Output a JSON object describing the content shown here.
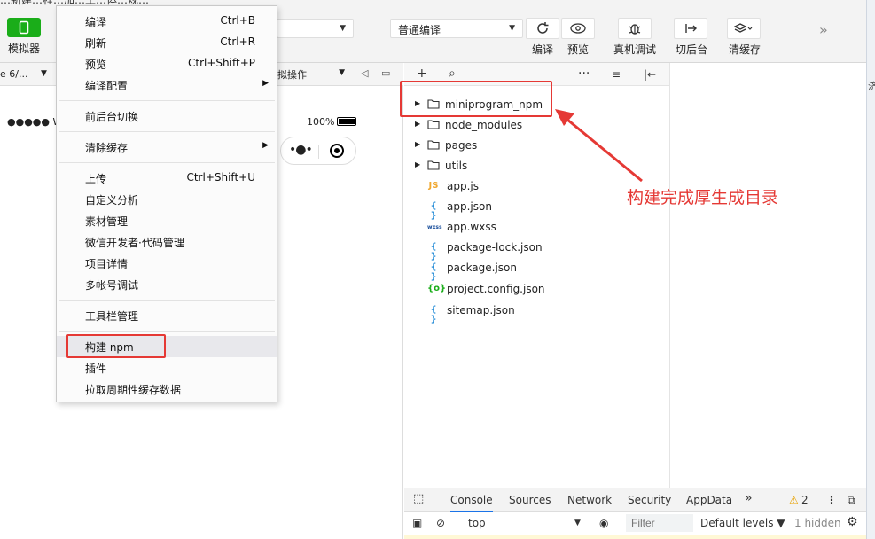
{
  "title_strip": "…新建…程…加…工…体…规…",
  "toolbar": {
    "simulator": "模拟器",
    "mode_select": "",
    "compile_select": "普通编译",
    "compile": "编译",
    "preview": "预览",
    "real_debug": "真机调试",
    "background": "切后台",
    "clear_cache": "清缓存",
    "more": "»"
  },
  "sim_bar": {
    "device": "e 6/...",
    "ops": "拟操作"
  },
  "phone": {
    "carrier": "●●●●● We",
    "battery": "100%"
  },
  "menu": {
    "items": [
      {
        "label": "编译",
        "shortcut": "Ctrl+B"
      },
      {
        "label": "刷新",
        "shortcut": "Ctrl+R"
      },
      {
        "label": "预览",
        "shortcut": "Ctrl+Shift+P"
      },
      {
        "label": "编译配置",
        "shortcut": ""
      },
      {
        "label": "前后台切换",
        "shortcut": ""
      },
      {
        "label": "清除缓存",
        "shortcut": ""
      },
      {
        "label": "上传",
        "shortcut": "Ctrl+Shift+U"
      },
      {
        "label": "自定义分析",
        "shortcut": ""
      },
      {
        "label": "素材管理",
        "shortcut": ""
      },
      {
        "label": "微信开发者·代码管理",
        "shortcut": ""
      },
      {
        "label": "项目详情",
        "shortcut": ""
      },
      {
        "label": "多帐号调试",
        "shortcut": ""
      },
      {
        "label": "工具栏管理",
        "shortcut": ""
      },
      {
        "label": "构建 npm",
        "shortcut": ""
      },
      {
        "label": "插件",
        "shortcut": ""
      },
      {
        "label": "拉取周期性缓存数据",
        "shortcut": ""
      }
    ]
  },
  "tree": {
    "files": [
      {
        "name": "miniprogram_npm",
        "type": "folder"
      },
      {
        "name": "node_modules",
        "type": "folder"
      },
      {
        "name": "pages",
        "type": "folder"
      },
      {
        "name": "utils",
        "type": "folder"
      },
      {
        "name": "app.js",
        "type": "js",
        "icon": "JS",
        "color": "#f0a830"
      },
      {
        "name": "app.json",
        "type": "json",
        "icon": "{ }",
        "color": "#2a8fd8"
      },
      {
        "name": "app.wxss",
        "type": "wxss",
        "icon": "wxss",
        "color": "#1a4f9c"
      },
      {
        "name": "package-lock.json",
        "type": "json",
        "icon": "{ }",
        "color": "#2a8fd8"
      },
      {
        "name": "package.json",
        "type": "json",
        "icon": "{ }",
        "color": "#2a8fd8"
      },
      {
        "name": "project.config.json",
        "type": "config",
        "icon": "{o}",
        "color": "#1aad19"
      },
      {
        "name": "sitemap.json",
        "type": "json",
        "icon": "{ }",
        "color": "#2a8fd8"
      }
    ]
  },
  "annotation": "构建完成厚生成目录",
  "devtools": {
    "tabs": [
      "Console",
      "Sources",
      "Network",
      "Security",
      "AppData"
    ],
    "more": "»",
    "warnings": "2",
    "context": "top",
    "filter_placeholder": "Filter",
    "levels": "Default levels ▼",
    "hidden": "1 hidden"
  },
  "right_strip": "济"
}
